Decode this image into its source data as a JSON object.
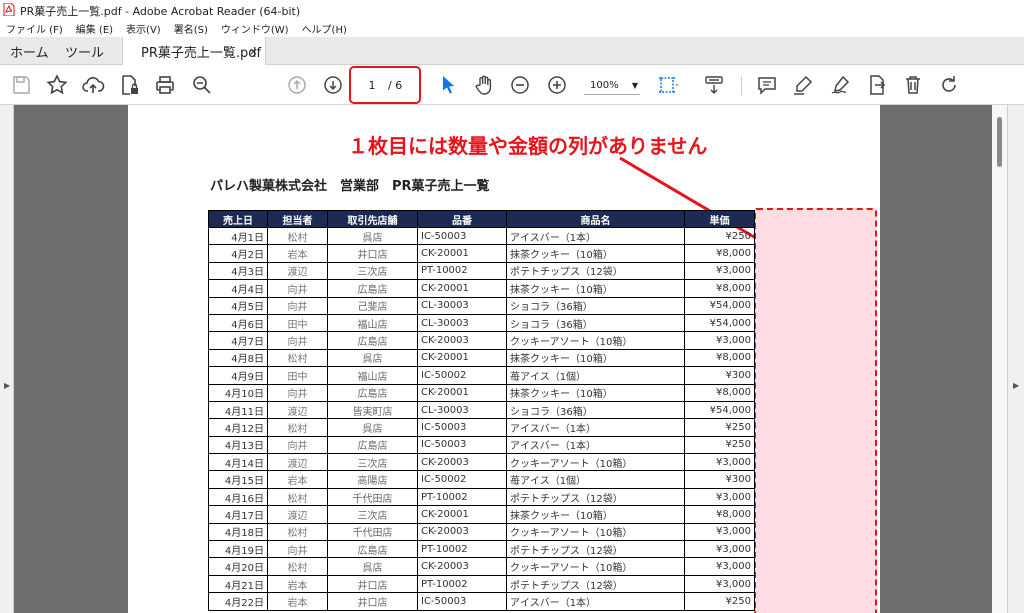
{
  "window": {
    "title": "PR菓子売上一覧.pdf - Adobe Acrobat Reader (64-bit)"
  },
  "menu": [
    "ファイル (F)",
    "編集 (E)",
    "表示(V)",
    "署名(S)",
    "ウィンドウ(W)",
    "ヘルプ(H)"
  ],
  "tabs": {
    "home": "ホーム",
    "tools": "ツール",
    "document": "PR菓子売上一覧.pdf",
    "close": "×"
  },
  "toolbar": {
    "page_current": "1",
    "page_total": "/ 6",
    "zoom": "100%"
  },
  "colors": {
    "accent_red": "#e8141c",
    "table_header": "#1d2b54",
    "highlight_fill": "#ffdce3",
    "doc_bg": "#6e6e6e"
  },
  "annotation": "１枚目には数量や金額の列がありません",
  "document": {
    "heading": "パレハ製菓株式会社　営業部　PR菓子売上一覧",
    "columns": [
      "売上日",
      "担当者",
      "取引先店舗",
      "品番",
      "商品名",
      "単価"
    ],
    "rows": [
      [
        "4月1日",
        "松村",
        "呉店",
        "IC-50003",
        "アイスバー（1本）",
        "¥250"
      ],
      [
        "4月2日",
        "岩本",
        "井口店",
        "CK-20001",
        "抹茶クッキー（10箱）",
        "¥8,000"
      ],
      [
        "4月3日",
        "渡辺",
        "三次店",
        "PT-10002",
        "ポテトチップス（12袋）",
        "¥3,000"
      ],
      [
        "4月4日",
        "向井",
        "広島店",
        "CK-20001",
        "抹茶クッキー（10箱）",
        "¥8,000"
      ],
      [
        "4月5日",
        "向井",
        "己斐店",
        "CL-30003",
        "ショコラ（36箱）",
        "¥54,000"
      ],
      [
        "4月6日",
        "田中",
        "福山店",
        "CL-30003",
        "ショコラ（36箱）",
        "¥54,000"
      ],
      [
        "4月7日",
        "向井",
        "広島店",
        "CK-20003",
        "クッキーアソート（10箱）",
        "¥3,000"
      ],
      [
        "4月8日",
        "松村",
        "呉店",
        "CK-20001",
        "抹茶クッキー（10箱）",
        "¥8,000"
      ],
      [
        "4月9日",
        "田中",
        "福山店",
        "IC-50002",
        "苺アイス（1個）",
        "¥300"
      ],
      [
        "4月10日",
        "向井",
        "広島店",
        "CK-20001",
        "抹茶クッキー（10箱）",
        "¥8,000"
      ],
      [
        "4月11日",
        "渡辺",
        "皆実町店",
        "CL-30003",
        "ショコラ（36箱）",
        "¥54,000"
      ],
      [
        "4月12日",
        "松村",
        "呉店",
        "IC-50003",
        "アイスバー（1本）",
        "¥250"
      ],
      [
        "4月13日",
        "向井",
        "広島店",
        "IC-50003",
        "アイスバー（1本）",
        "¥250"
      ],
      [
        "4月14日",
        "渡辺",
        "三次店",
        "CK-20003",
        "クッキーアソート（10箱）",
        "¥3,000"
      ],
      [
        "4月15日",
        "岩本",
        "高陽店",
        "IC-50002",
        "苺アイス（1個）",
        "¥300"
      ],
      [
        "4月16日",
        "松村",
        "千代田店",
        "PT-10002",
        "ポテトチップス（12袋）",
        "¥3,000"
      ],
      [
        "4月17日",
        "渡辺",
        "三次店",
        "CK-20001",
        "抹茶クッキー（10箱）",
        "¥8,000"
      ],
      [
        "4月18日",
        "松村",
        "千代田店",
        "CK-20003",
        "クッキーアソート（10箱）",
        "¥3,000"
      ],
      [
        "4月19日",
        "向井",
        "広島店",
        "PT-10002",
        "ポテトチップス（12袋）",
        "¥3,000"
      ],
      [
        "4月20日",
        "松村",
        "呉店",
        "CK-20003",
        "クッキーアソート（10箱）",
        "¥3,000"
      ],
      [
        "4月21日",
        "岩本",
        "井口店",
        "PT-10002",
        "ポテトチップス（12袋）",
        "¥3,000"
      ],
      [
        "4月22日",
        "岩本",
        "井口店",
        "IC-50003",
        "アイスバー（1本）",
        "¥250"
      ]
    ]
  }
}
